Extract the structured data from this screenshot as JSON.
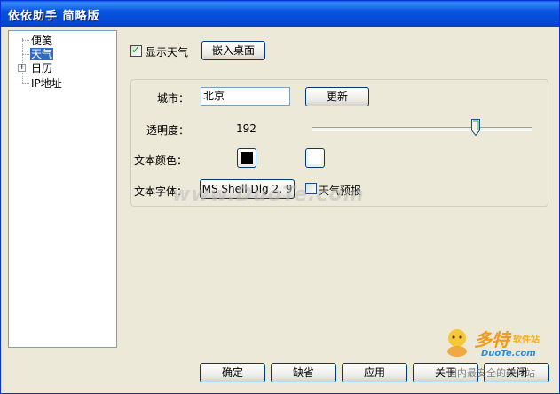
{
  "window": {
    "title": "依依助手  简略版"
  },
  "tree": {
    "items": [
      {
        "label": "便笺",
        "selected": false,
        "expandable": false
      },
      {
        "label": "天气",
        "selected": true,
        "expandable": false
      },
      {
        "label": "日历",
        "selected": false,
        "expandable": true
      },
      {
        "label": "IP地址",
        "selected": false,
        "expandable": false
      }
    ]
  },
  "top": {
    "show_weather_label": "显示天气",
    "show_weather_checked": true,
    "embed_desktop_label": "嵌入桌面"
  },
  "settings": {
    "city_label": "城市：",
    "city_value": "北京",
    "update_label": "更新",
    "opacity_label": "透明度：",
    "opacity_value": "192",
    "text_color_label": "文本颜色：",
    "text_color": "#000000",
    "bg_color": "#ffffff",
    "font_label": "文本字体：",
    "font_value": "MS Shell Dlg 2, 9",
    "forecast_label": "天气预报",
    "forecast_checked": false
  },
  "footer": {
    "ok": "确定",
    "default": "缺省",
    "apply": "应用",
    "about": "关于",
    "close": "关闭"
  },
  "overlay": {
    "watermark": "www.DuoTe.com",
    "logo_main": "多特",
    "logo_sub": "软件站",
    "logo_url": "DuoTe.com",
    "logo_slogan": "国内最安全的软件站"
  }
}
